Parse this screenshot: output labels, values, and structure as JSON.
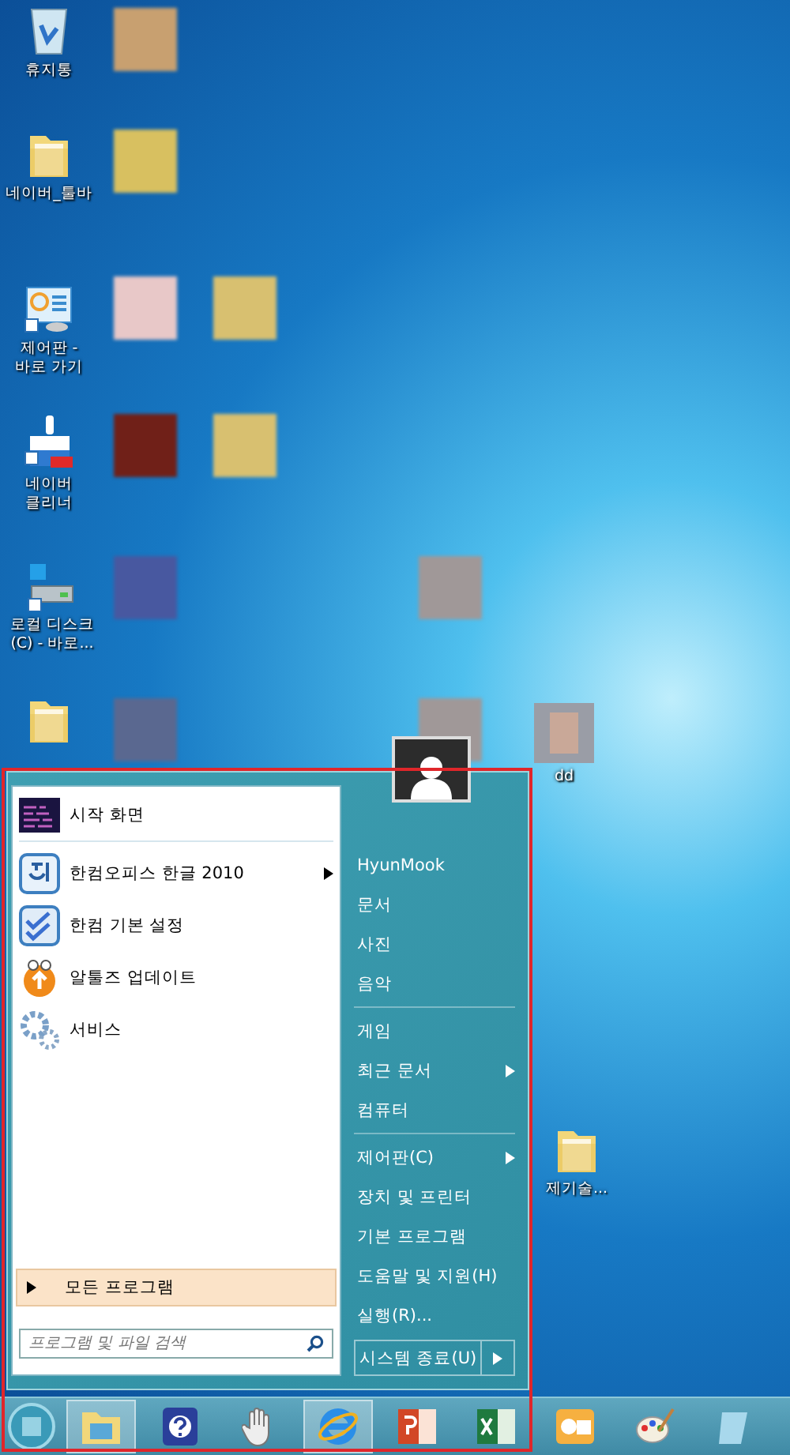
{
  "desktop_icons": [
    {
      "label": "휴지통",
      "kind": "bin"
    },
    {
      "label": "네이버_툴바",
      "kind": "folder"
    },
    {
      "label": "제어판 -\n바로 가기",
      "kind": "panel"
    },
    {
      "label": "네이버\n클리너",
      "kind": "cleaner"
    },
    {
      "label": "로컬 디스크\n(C) - 바로...",
      "kind": "disk"
    },
    {
      "kind": "folder"
    },
    {
      "label": "dd",
      "kind": "blurred"
    },
    {
      "label": "제기술...",
      "kind": "folder"
    }
  ],
  "start_menu": {
    "pinned": [
      {
        "label": "시작 화면",
        "kind": "tiles",
        "has_submenu": false,
        "separator_after": true
      },
      {
        "label": "한컴오피스 한글 2010",
        "kind": "hangul",
        "has_submenu": true,
        "separator_after": false
      },
      {
        "label": "한컴 기본 설정",
        "kind": "check",
        "has_submenu": false,
        "separator_after": false
      },
      {
        "label": "알툴즈 업데이트",
        "kind": "update",
        "has_submenu": false,
        "separator_after": false
      },
      {
        "label": "서비스",
        "kind": "gears",
        "has_submenu": false,
        "separator_after": false
      }
    ],
    "all_programs": {
      "label": "모든 프로그램",
      "selected": true
    },
    "search": {
      "placeholder": "프로그램 및 파일 검색"
    },
    "user_name": "HyunMook",
    "places": [
      {
        "label": "문서",
        "has_submenu": false,
        "separator_before": false
      },
      {
        "label": "사진",
        "has_submenu": false,
        "separator_before": false
      },
      {
        "label": "음악",
        "has_submenu": false,
        "separator_before": false
      },
      {
        "label": "게임",
        "has_submenu": false,
        "separator_before": true
      },
      {
        "label": "최근 문서",
        "has_submenu": true,
        "separator_before": false
      },
      {
        "label": "컴퓨터",
        "has_submenu": false,
        "separator_before": false
      },
      {
        "label": "제어판(C)",
        "has_submenu": true,
        "separator_before": true
      },
      {
        "label": "장치 및 프린터",
        "has_submenu": false,
        "separator_before": false
      },
      {
        "label": "기본 프로그램",
        "has_submenu": false,
        "separator_before": false
      },
      {
        "label": "도움말 및 지원(H)",
        "has_submenu": false,
        "separator_before": false
      },
      {
        "label": "실행(R)...",
        "has_submenu": false,
        "separator_before": false
      }
    ],
    "shutdown": {
      "label": "시스템 종료(U)"
    }
  },
  "taskbar": [
    {
      "kind": "folder",
      "running": true
    },
    {
      "kind": "help",
      "running": false
    },
    {
      "kind": "hand",
      "running": false
    },
    {
      "kind": "ie",
      "running": true
    },
    {
      "kind": "powerpoint",
      "running": false
    },
    {
      "kind": "excel",
      "running": false
    },
    {
      "kind": "outlook",
      "running": false
    },
    {
      "kind": "paint",
      "running": false
    },
    {
      "kind": "other",
      "running": false
    }
  ]
}
